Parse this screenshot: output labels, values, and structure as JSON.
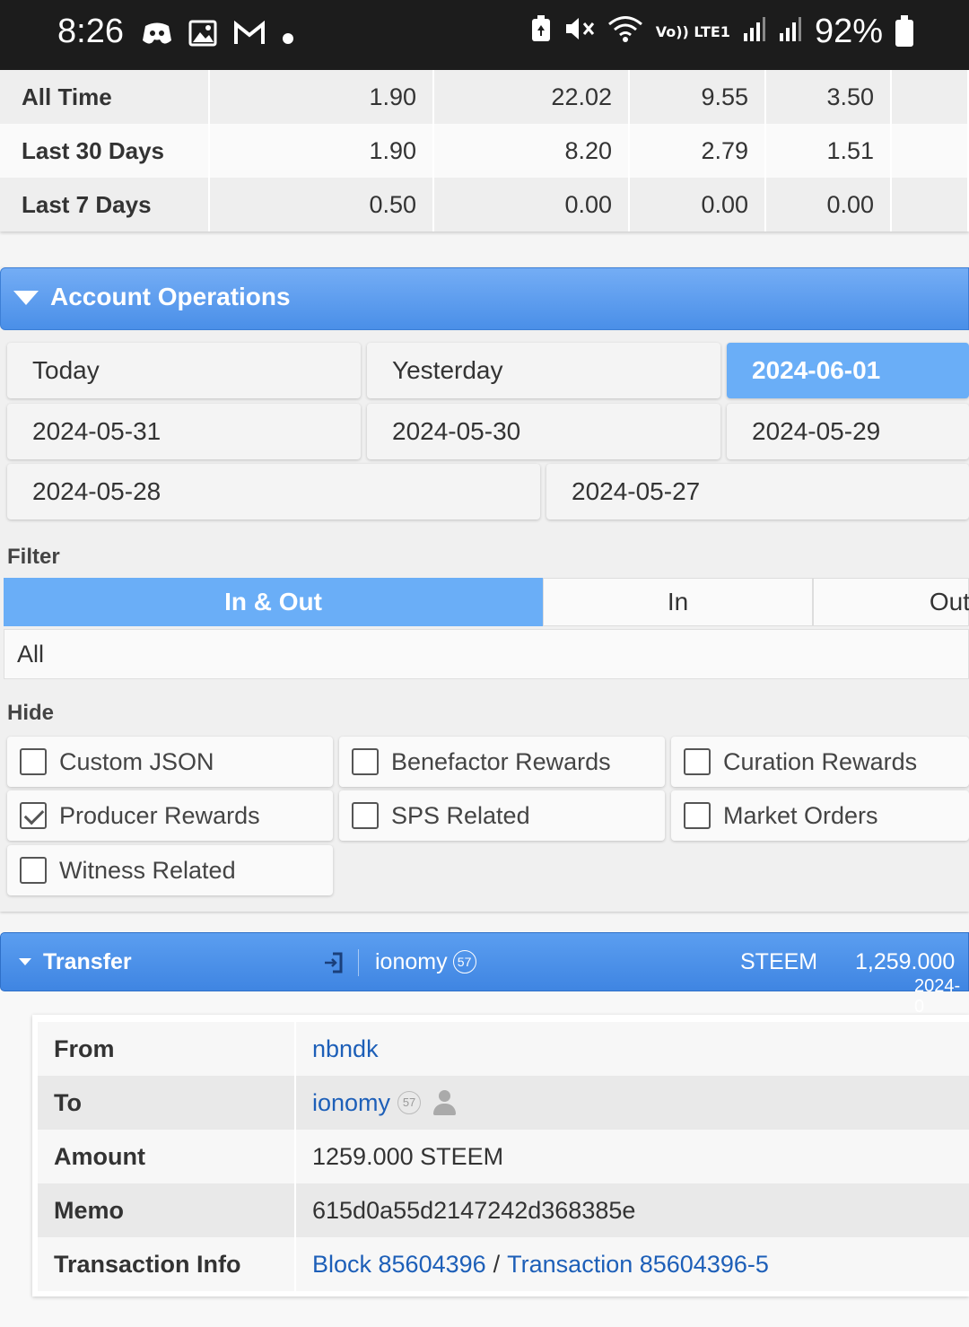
{
  "status_bar": {
    "time": "8:26",
    "left_icons": [
      "discord-icon",
      "image-icon",
      "gmail-icon",
      "dot-icon"
    ],
    "right_icons": [
      "battery-saver-icon",
      "mute-icon",
      "wifi-icon",
      "volte-icon",
      "signal-icon",
      "signal-icon"
    ],
    "network_label": "Vo)) LTE1",
    "battery": "92%"
  },
  "stats": {
    "rows": [
      {
        "label": "All Time",
        "values": [
          "1.90",
          "22.02",
          "9.55",
          "3.50"
        ]
      },
      {
        "label": "Last 30 Days",
        "values": [
          "1.90",
          "8.20",
          "2.79",
          "1.51"
        ]
      },
      {
        "label": "Last 7 Days",
        "values": [
          "0.50",
          "0.00",
          "0.00",
          "0.00"
        ]
      }
    ]
  },
  "ops": {
    "title": "Account Operations",
    "dates": [
      "Today",
      "Yesterday",
      "2024-06-01",
      "2024-05-31",
      "2024-05-30",
      "2024-05-29",
      "2024-05-28",
      "2024-05-27"
    ],
    "active_date": "2024-06-01",
    "filter_label": "Filter",
    "filter_options": [
      "In & Out",
      "In",
      "Out"
    ],
    "filter_active": "In & Out",
    "type_select": "All",
    "hide_label": "Hide",
    "hide_options": [
      {
        "label": "Custom JSON",
        "checked": false
      },
      {
        "label": "Benefactor Rewards",
        "checked": false
      },
      {
        "label": "Curation Rewards",
        "checked": false
      },
      {
        "label": "Producer Rewards",
        "checked": true
      },
      {
        "label": "SPS Related",
        "checked": false
      },
      {
        "label": "Market Orders",
        "checked": false
      },
      {
        "label": "Witness Related",
        "checked": false
      }
    ]
  },
  "transfer": {
    "title": "Transfer",
    "account": "ionomy",
    "reputation": "57",
    "asset": "STEEM",
    "amount": "1,259.000",
    "date_partial": "2024-0",
    "details": {
      "from_label": "From",
      "from": "nbndk",
      "to_label": "To",
      "to": "ionomy",
      "to_rep": "57",
      "amount_label": "Amount",
      "amount": "1259.000 STEEM",
      "memo_label": "Memo",
      "memo": "615d0a55d2147242d368385e",
      "tx_label": "Transaction Info",
      "block": "Block 85604396",
      "separator": "/",
      "transaction": "Transaction 85604396-5"
    }
  },
  "colors": {
    "accent_blue": "#6aaef7",
    "header_blue": "#4a8fe8",
    "link_blue": "#1d5fb8"
  }
}
